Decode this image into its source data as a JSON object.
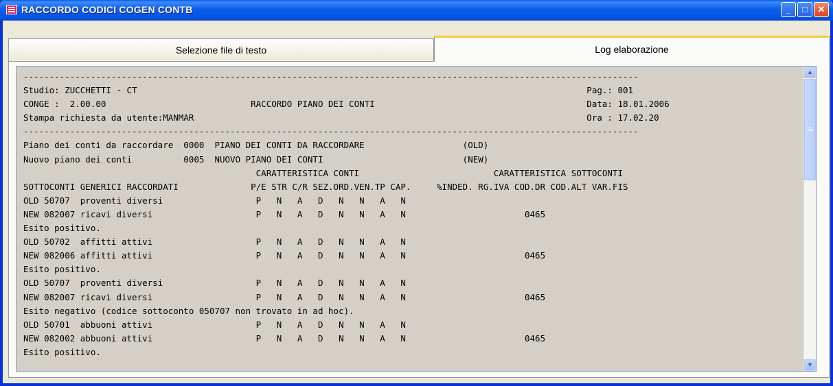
{
  "window": {
    "title": "RACCORDO CODICI COGEN CONTB"
  },
  "tabs": [
    {
      "label": "Selezione file di testo",
      "active": false
    },
    {
      "label": "Log elaborazione",
      "active": true
    }
  ],
  "log": {
    "lines": [
      "-----------------------------------------------------------------------------------------------------------------------",
      "Studio: ZUCCHETTI - CT                                                                                       Pag.: 001",
      "CONGE :  2.00.00                            RACCORDO PIANO DEI CONTI                                         Data: 18.01.2006",
      "Stampa richiesta da utente:MANMAR                                                                            Ora : 17.02.20",
      "-----------------------------------------------------------------------------------------------------------------------",
      "Piano dei conti da raccordare  0000  PIANO DEI CONTI DA RACCORDARE                   (OLD)",
      "Nuovo piano dei conti          0005  NUOVO PIANO DEI CONTI                           (NEW)",
      "                                             CARATTERISTICA CONTI                          CARATTERISTICA SOTTOCONTI",
      "SOTTOCONTI GENERICI RACCORDATI              P/E STR C/R SEZ.ORD.VEN.TP CAP.     %INDED. RG.IVA COD.DR COD.ALT VAR.FIS",
      "OLD 50707  proventi diversi                  P   N   A   D   N   N   A   N",
      "NEW 082007 ricavi diversi                    P   N   A   D   N   N   A   N                       0465",
      "Esito positivo.",
      "OLD 50702  affitti attivi                    P   N   A   D   N   N   A   N",
      "NEW 082006 affitti attivi                    P   N   A   D   N   N   A   N                       0465",
      "Esito positivo.",
      "OLD 50707  proventi diversi                  P   N   A   D   N   N   A   N",
      "NEW 082007 ricavi diversi                    P   N   A   D   N   N   A   N                       0465",
      "Esito negativo (codice sottoconto 050707 non trovato in ad hoc).",
      "OLD 50701  abbuoni attivi                    P   N   A   D   N   N   A   N",
      "NEW 082002 abbuoni attivi                    P   N   A   D   N   N   A   N                       0465",
      "Esito positivo."
    ]
  },
  "icons": {
    "app": "app-window-icon",
    "minimize": "minimize-icon",
    "maximize": "maximize-icon",
    "close": "close-icon",
    "scroll_up": "scroll-up-arrow-icon",
    "scroll_down": "scroll-down-arrow-icon"
  }
}
